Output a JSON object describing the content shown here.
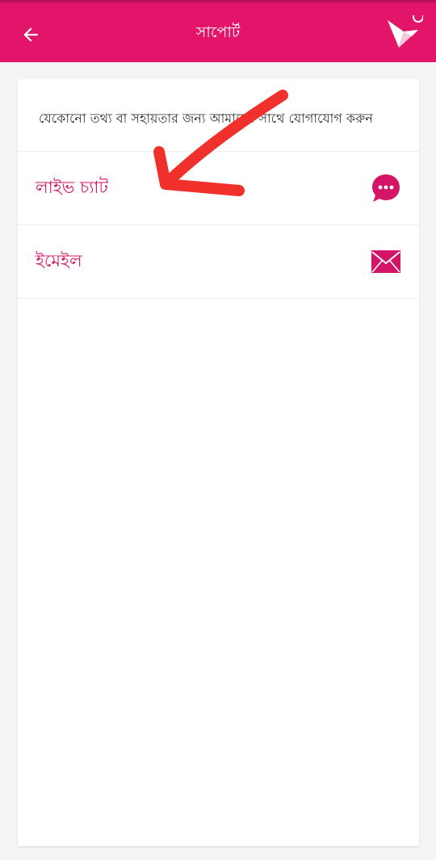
{
  "header": {
    "title": "সাপোর্ট",
    "back_icon": "arrow-left-icon",
    "logo_icon": "origami-bird-logo",
    "background_color": "#e2156b"
  },
  "support": {
    "description": "যেকোনো তথ্য বা সহায়তার জন্য আমাদের সাথে যোগাযোগ করুন",
    "options": [
      {
        "label": "লাইভ চ্যাট",
        "icon": "chat-bubble-icon"
      },
      {
        "label": "ইমেইল",
        "icon": "envelope-icon"
      }
    ],
    "accent_color": "#d41466"
  },
  "annotation": {
    "type": "arrow",
    "color": "#f0302a",
    "points_to": "লাইভ চ্যাট"
  }
}
